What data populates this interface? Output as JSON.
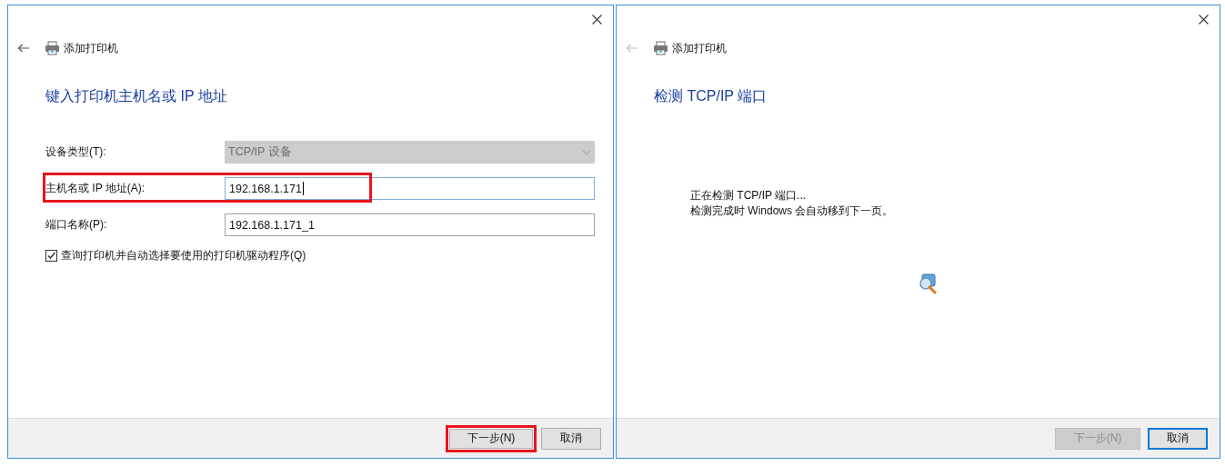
{
  "dialogs": [
    {
      "kind": "form",
      "back_enabled": true,
      "title": "添加打印机",
      "heading": "键入打印机主机名或 IP 地址",
      "fields": [
        {
          "label": "设备类型(T):",
          "value": "TCP/IP 设备",
          "kind": "select",
          "disabled": true,
          "focused": false,
          "highlighted": false
        },
        {
          "label": "主机名或 IP 地址(A):",
          "value": "192.168.1.171",
          "kind": "text",
          "disabled": false,
          "focused": true,
          "highlighted": true
        },
        {
          "label": "端口名称(P):",
          "value": "192.168.1.171_1",
          "kind": "text",
          "disabled": false,
          "focused": false,
          "highlighted": false
        }
      ],
      "checkbox": {
        "label": "查询打印机并自动选择要使用的打印机驱动程序(Q)",
        "checked": true
      },
      "buttons": [
        {
          "label": "下一步(N)",
          "disabled": false,
          "default": false,
          "highlighted": true
        },
        {
          "label": "取消",
          "disabled": false,
          "default": false,
          "highlighted": false
        }
      ]
    },
    {
      "kind": "progress",
      "back_enabled": false,
      "title": "添加打印机",
      "heading": "检测 TCP/IP 端口",
      "messages": [
        "正在检测 TCP/IP 端口...",
        "检测完成时 Windows 会自动移到下一页。"
      ],
      "buttons": [
        {
          "label": "下一步(N)",
          "disabled": true,
          "default": false,
          "highlighted": false
        },
        {
          "label": "取消",
          "disabled": false,
          "default": true,
          "highlighted": false
        }
      ]
    }
  ]
}
